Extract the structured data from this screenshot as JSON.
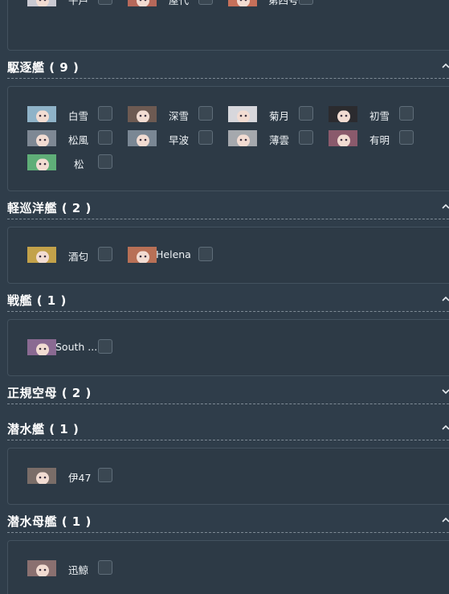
{
  "sections": [
    {
      "title": "",
      "expanded": true,
      "ships": [
        {
          "name": "平戸",
          "avatar_color": "#c9c9d2"
        },
        {
          "name": "屋代",
          "avatar_color": "#b6685a"
        },
        {
          "name": "第四号...",
          "avatar_color": "#c6705a"
        }
      ]
    },
    {
      "title": "駆逐艦 ( 9 )",
      "expanded": true,
      "ships": [
        {
          "name": "白雪",
          "avatar_color": "#8fb3c8"
        },
        {
          "name": "深雪",
          "avatar_color": "#6d5a52"
        },
        {
          "name": "菊月",
          "avatar_color": "#d7d7dc"
        },
        {
          "name": "初雪",
          "avatar_color": "#2b2b2f"
        },
        {
          "name": "松風",
          "avatar_color": "#7e8894"
        },
        {
          "name": "早波",
          "avatar_color": "#7a8794"
        },
        {
          "name": "薄雲",
          "avatar_color": "#a5a8ad"
        },
        {
          "name": "有明",
          "avatar_color": "#8a5a6c"
        },
        {
          "name": "松",
          "avatar_color": "#5fae78"
        }
      ]
    },
    {
      "title": "軽巡洋艦 ( 2 )",
      "expanded": true,
      "ships": [
        {
          "name": "酒匂",
          "avatar_color": "#c3a24a"
        },
        {
          "name": "Helena",
          "avatar_color": "#b87056"
        }
      ]
    },
    {
      "title": "戦艦 ( 1 )",
      "expanded": true,
      "ships": [
        {
          "name": "South ...",
          "avatar_color": "#8a6a92"
        }
      ]
    },
    {
      "title": "正規空母 ( 2 )",
      "expanded": false,
      "ships": []
    },
    {
      "title": "潜水艦 ( 1 )",
      "expanded": true,
      "ships": [
        {
          "name": "伊47",
          "avatar_color": "#7a6d68"
        }
      ]
    },
    {
      "title": "潜水母艦 ( 1 )",
      "expanded": true,
      "ships": [
        {
          "name": "迅鯨",
          "avatar_color": "#8a7070"
        }
      ]
    }
  ]
}
